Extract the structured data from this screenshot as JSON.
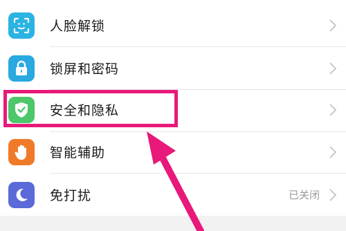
{
  "settings": {
    "items": [
      {
        "label": "人脸解锁",
        "icon": "face-unlock-icon",
        "icon_color": "#2bb3e3",
        "value": ""
      },
      {
        "label": "锁屏和密码",
        "icon": "lock-icon",
        "icon_color": "#2aa8e0",
        "value": ""
      },
      {
        "label": "安全和隐私",
        "icon": "shield-check-icon",
        "icon_color": "#4cc76a",
        "value": ""
      },
      {
        "label": "智能辅助",
        "icon": "hand-icon",
        "icon_color": "#f07a2a",
        "value": ""
      },
      {
        "label": "免打扰",
        "icon": "moon-icon",
        "icon_color": "#5b6ad8",
        "value": "已关闭"
      }
    ]
  },
  "annotation": {
    "highlight_color": "#e8197a",
    "highlighted_item": "安全和隐私"
  }
}
